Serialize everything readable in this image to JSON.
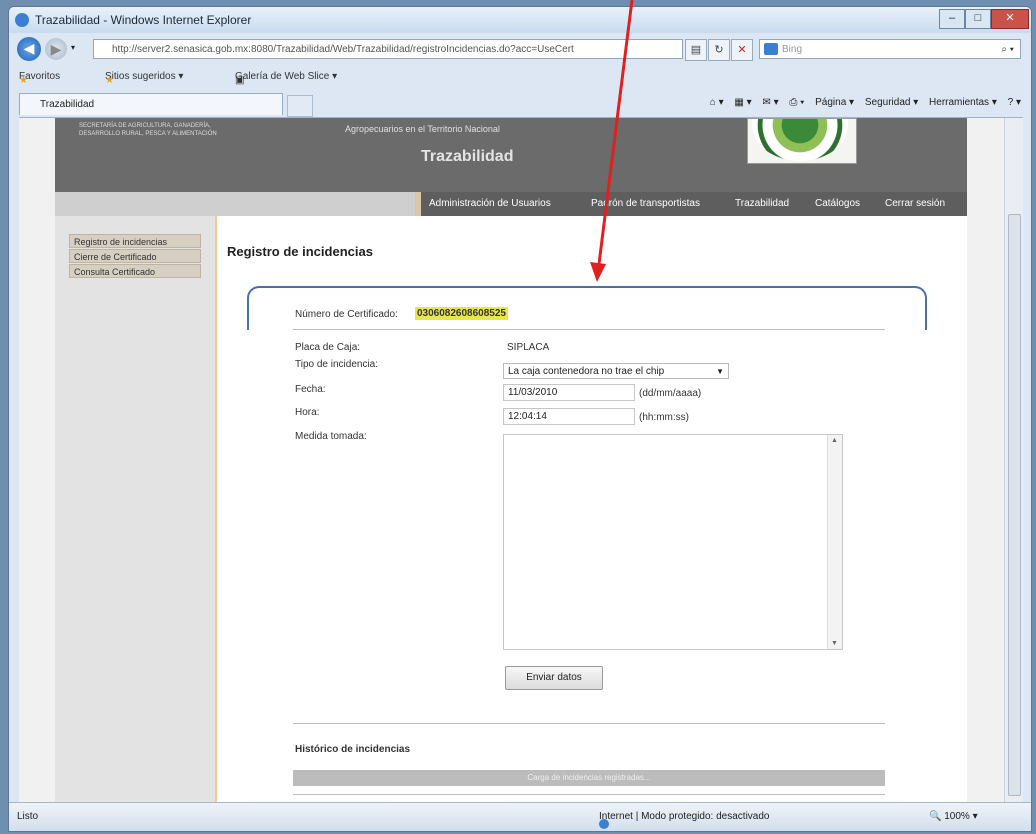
{
  "window": {
    "title": "Trazabilidad - Windows Internet Explorer",
    "controls": [
      "–",
      "□",
      "✕"
    ]
  },
  "addressbar": {
    "url": "http://server2.senasica.gob.mx:8080/Trazabilidad/Web/Trazabilidad/registroIncidencias.do?acc=UseCert",
    "search_placeholder": "Bing"
  },
  "favorites": {
    "favoritos": "Favoritos",
    "sitios_sugeridos": "Sitios sugeridos ▾",
    "galeria": "Galería de Web Slice ▾"
  },
  "tab": {
    "label": "Trazabilidad"
  },
  "commandbar": {
    "pagina": "Página ▾",
    "seguridad": "Seguridad ▾",
    "herramientas": "Herramientas ▾",
    "help": "? ▾"
  },
  "header": {
    "secretaria": "SECRETARÍA DE AGRICULTURA, GANADERÍA, DESARROLLO RURAL, PESCA Y ALIMENTACIÓN",
    "agro": "Agropecuarios en el Territorio Nacional",
    "title": "Trazabilidad"
  },
  "nav": {
    "items": [
      "Administración de Usuarios",
      "Padrón de transportistas",
      "Trazabilidad",
      "Catálogos",
      "Cerrar sesión"
    ]
  },
  "sidebar": {
    "items": [
      "Registro de incidencias",
      "Cierre de Certificado",
      "Consulta Certificado"
    ]
  },
  "form": {
    "title": "Registro de incidencias",
    "cert_label": "Número de Certificado:",
    "cert_value": "0306082608608525",
    "placa_label": "Placa de Caja:",
    "placa_value": "SIPLACA",
    "tipo_label": "Tipo de incidencia:",
    "tipo_value": "La caja contenedora no trae el chip",
    "fecha_label": "Fecha:",
    "fecha_value": "11/03/2010",
    "fecha_hint": "(dd/mm/aaaa)",
    "hora_label": "Hora:",
    "hora_value": "12:04:14",
    "hora_hint": "(hh:mm:ss)",
    "medida_label": "Medida tomada:",
    "submit": "Enviar datos",
    "historico": "Histórico de incidencias",
    "historico_empty": "Carga de incidencias registradas..."
  },
  "status": {
    "left": "Listo",
    "zone": "Internet | Modo protegido: desactivado",
    "zoom": "100%"
  },
  "colors": {
    "highlight": "#e8e64a",
    "annotation_arrow": "#e02020",
    "header_bg": "#6b6b6b"
  }
}
